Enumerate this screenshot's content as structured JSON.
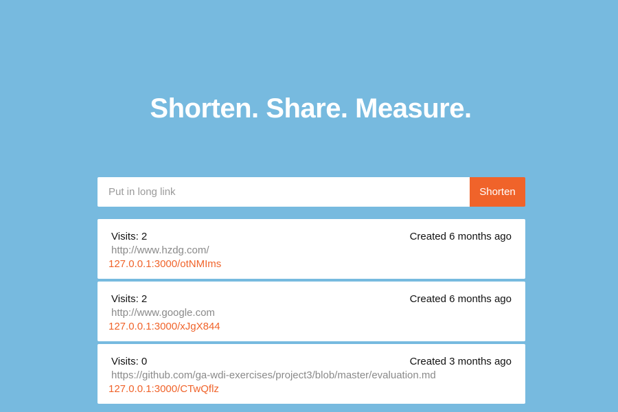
{
  "hero": {
    "headline": "Shorten. Share. Measure."
  },
  "form": {
    "placeholder": "Put in long link",
    "value": "",
    "button_label": "Shorten"
  },
  "links": [
    {
      "visits": "Visits: 2",
      "created": "Created 6 months ago",
      "long_url": "http://www.hzdg.com/",
      "short_url": "127.0.0.1:3000/otNMIms"
    },
    {
      "visits": "Visits: 2",
      "created": "Created 6 months ago",
      "long_url": "http://www.google.com",
      "short_url": "127.0.0.1:3000/xJgX844"
    },
    {
      "visits": "Visits: 0",
      "created": "Created 3 months ago",
      "long_url": "https://github.com/ga-wdi-exercises/project3/blob/master/evaluation.md",
      "short_url": "127.0.0.1:3000/CTwQflz"
    }
  ],
  "colors": {
    "background": "#77badf",
    "accent": "#f0632a",
    "card": "#ffffff"
  }
}
